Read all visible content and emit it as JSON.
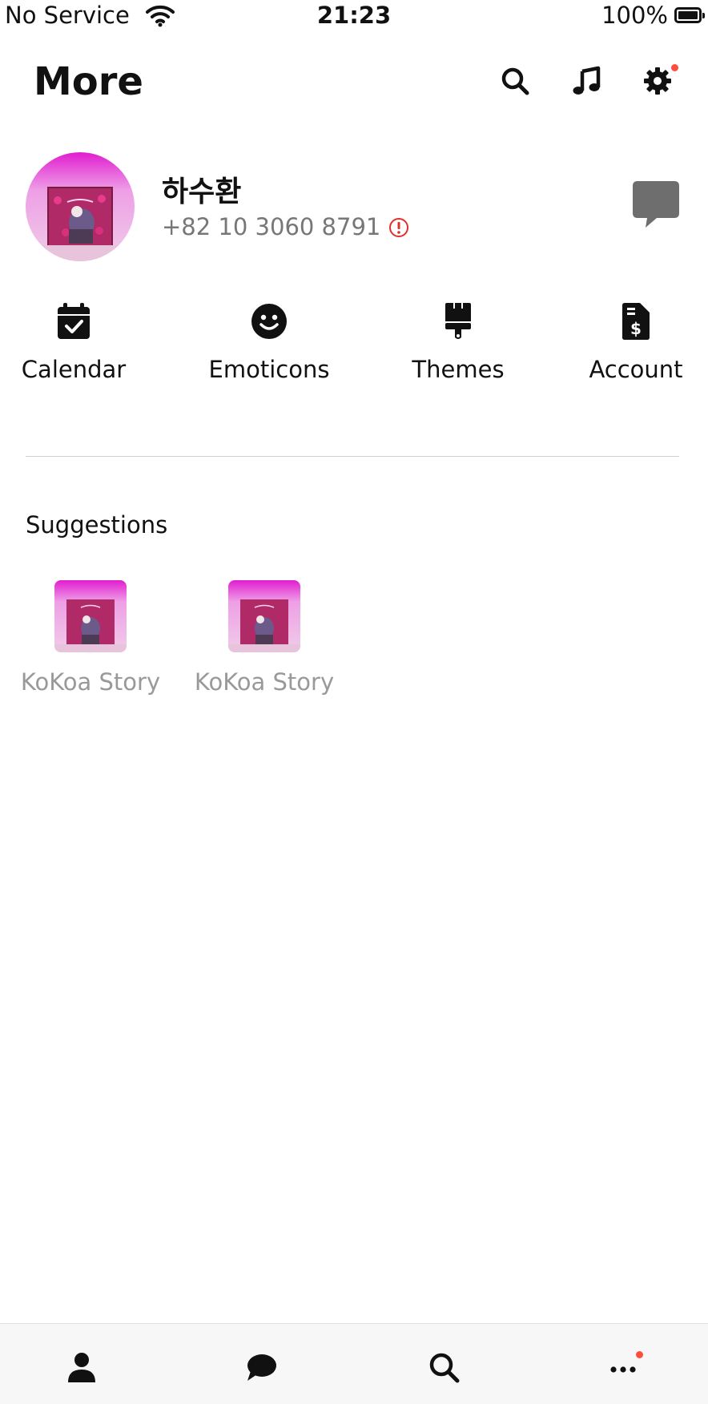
{
  "status_bar": {
    "carrier": "No Service",
    "time": "21:23",
    "battery": "100%"
  },
  "header": {
    "title": "More",
    "icons": [
      "search-icon",
      "music-icon",
      "gear-icon"
    ],
    "settings_badge_color": "#ff4d3d"
  },
  "profile": {
    "name": "하수환",
    "phone": "+82 10 3060 8791",
    "alert_color": "#e0302a"
  },
  "shortcuts": [
    {
      "label": "Calendar",
      "icon": "calendar-check-icon"
    },
    {
      "label": "Emoticons",
      "icon": "smiley-icon"
    },
    {
      "label": "Themes",
      "icon": "paintbrush-icon"
    },
    {
      "label": "Account",
      "icon": "invoice-dollar-icon"
    }
  ],
  "suggestions": {
    "title": "Suggestions",
    "items": [
      {
        "label": "KoKoa Story"
      },
      {
        "label": "KoKoa Story"
      }
    ]
  },
  "bottom_tabs": [
    {
      "icon": "person-icon"
    },
    {
      "icon": "chat-icon"
    },
    {
      "icon": "search-icon"
    },
    {
      "icon": "more-dots-icon"
    }
  ],
  "colors": {
    "accent_dot": "#ff4d3d",
    "photo_pink": "#e22fc8"
  }
}
